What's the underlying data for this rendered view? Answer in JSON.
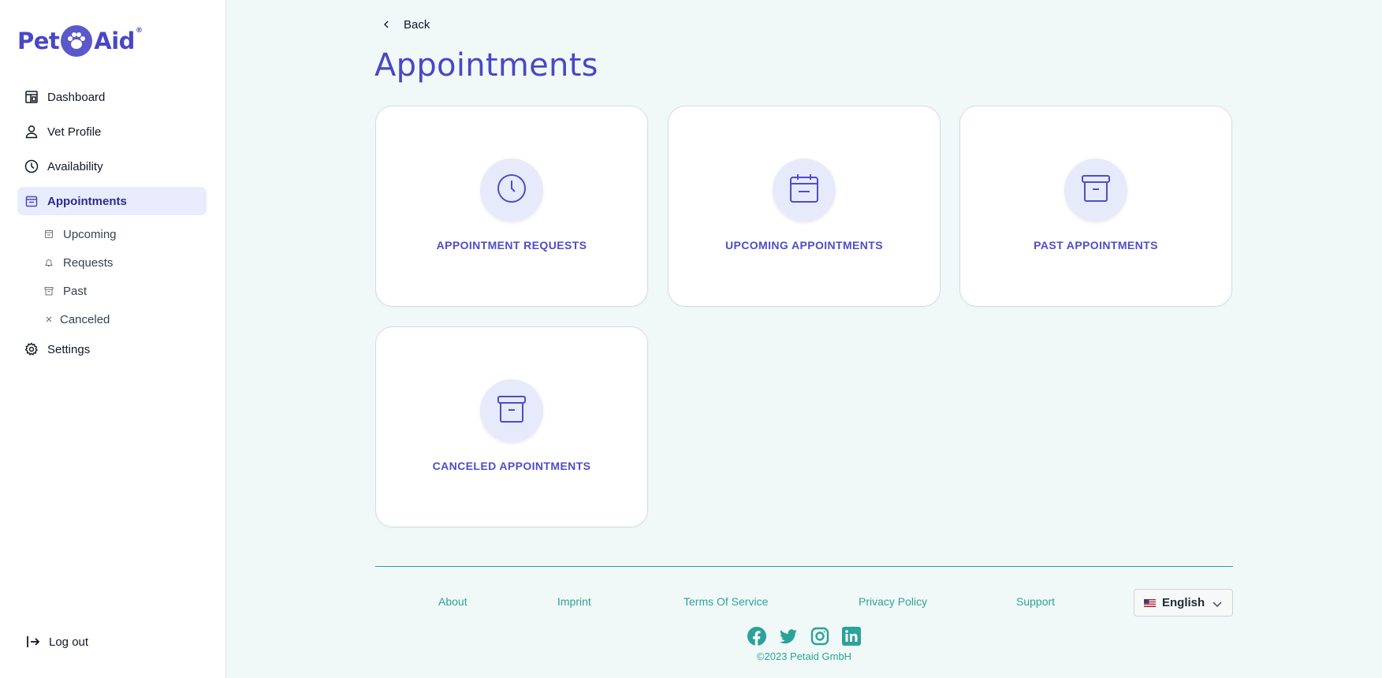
{
  "brand": {
    "name_left": "Pet",
    "name_right": "Aid",
    "mark": "®"
  },
  "sidebar": {
    "items": [
      {
        "label": "Dashboard",
        "icon": "dashboard-icon"
      },
      {
        "label": "Vet Profile",
        "icon": "user-icon"
      },
      {
        "label": "Availability",
        "icon": "clock-icon"
      },
      {
        "label": "Appointments",
        "icon": "calendar-icon",
        "active": true
      },
      {
        "label": "Settings",
        "icon": "gear-icon"
      }
    ],
    "subitems": [
      {
        "label": "Upcoming",
        "icon": "calendar-icon"
      },
      {
        "label": "Requests",
        "icon": "bell-icon"
      },
      {
        "label": "Past",
        "icon": "archive-icon"
      },
      {
        "label": "Canceled",
        "icon": "close-icon"
      }
    ],
    "logout": "Log out"
  },
  "back_label": "Back",
  "page_title": "Appointments",
  "cards": [
    {
      "label": "APPOINTMENT REQUESTS",
      "icon": "clock-icon"
    },
    {
      "label": "UPCOMING APPOINTMENTS",
      "icon": "calendar-icon"
    },
    {
      "label": "PAST APPOINTMENTS",
      "icon": "archive-icon"
    },
    {
      "label": "CANCELED APPOINTMENTS",
      "icon": "archive-icon"
    }
  ],
  "footer": {
    "links": [
      "About",
      "Imprint",
      "Terms Of Service",
      "Privacy Policy",
      "Support"
    ],
    "language": "English",
    "socials": [
      "facebook-icon",
      "twitter-icon",
      "instagram-icon",
      "linkedin-icon"
    ],
    "copyright": "©2023 Petaid GmbH"
  },
  "colors": {
    "brand": "#4a47c4",
    "accent": "#2aa39a",
    "active_bg": "#e8ecfd"
  }
}
